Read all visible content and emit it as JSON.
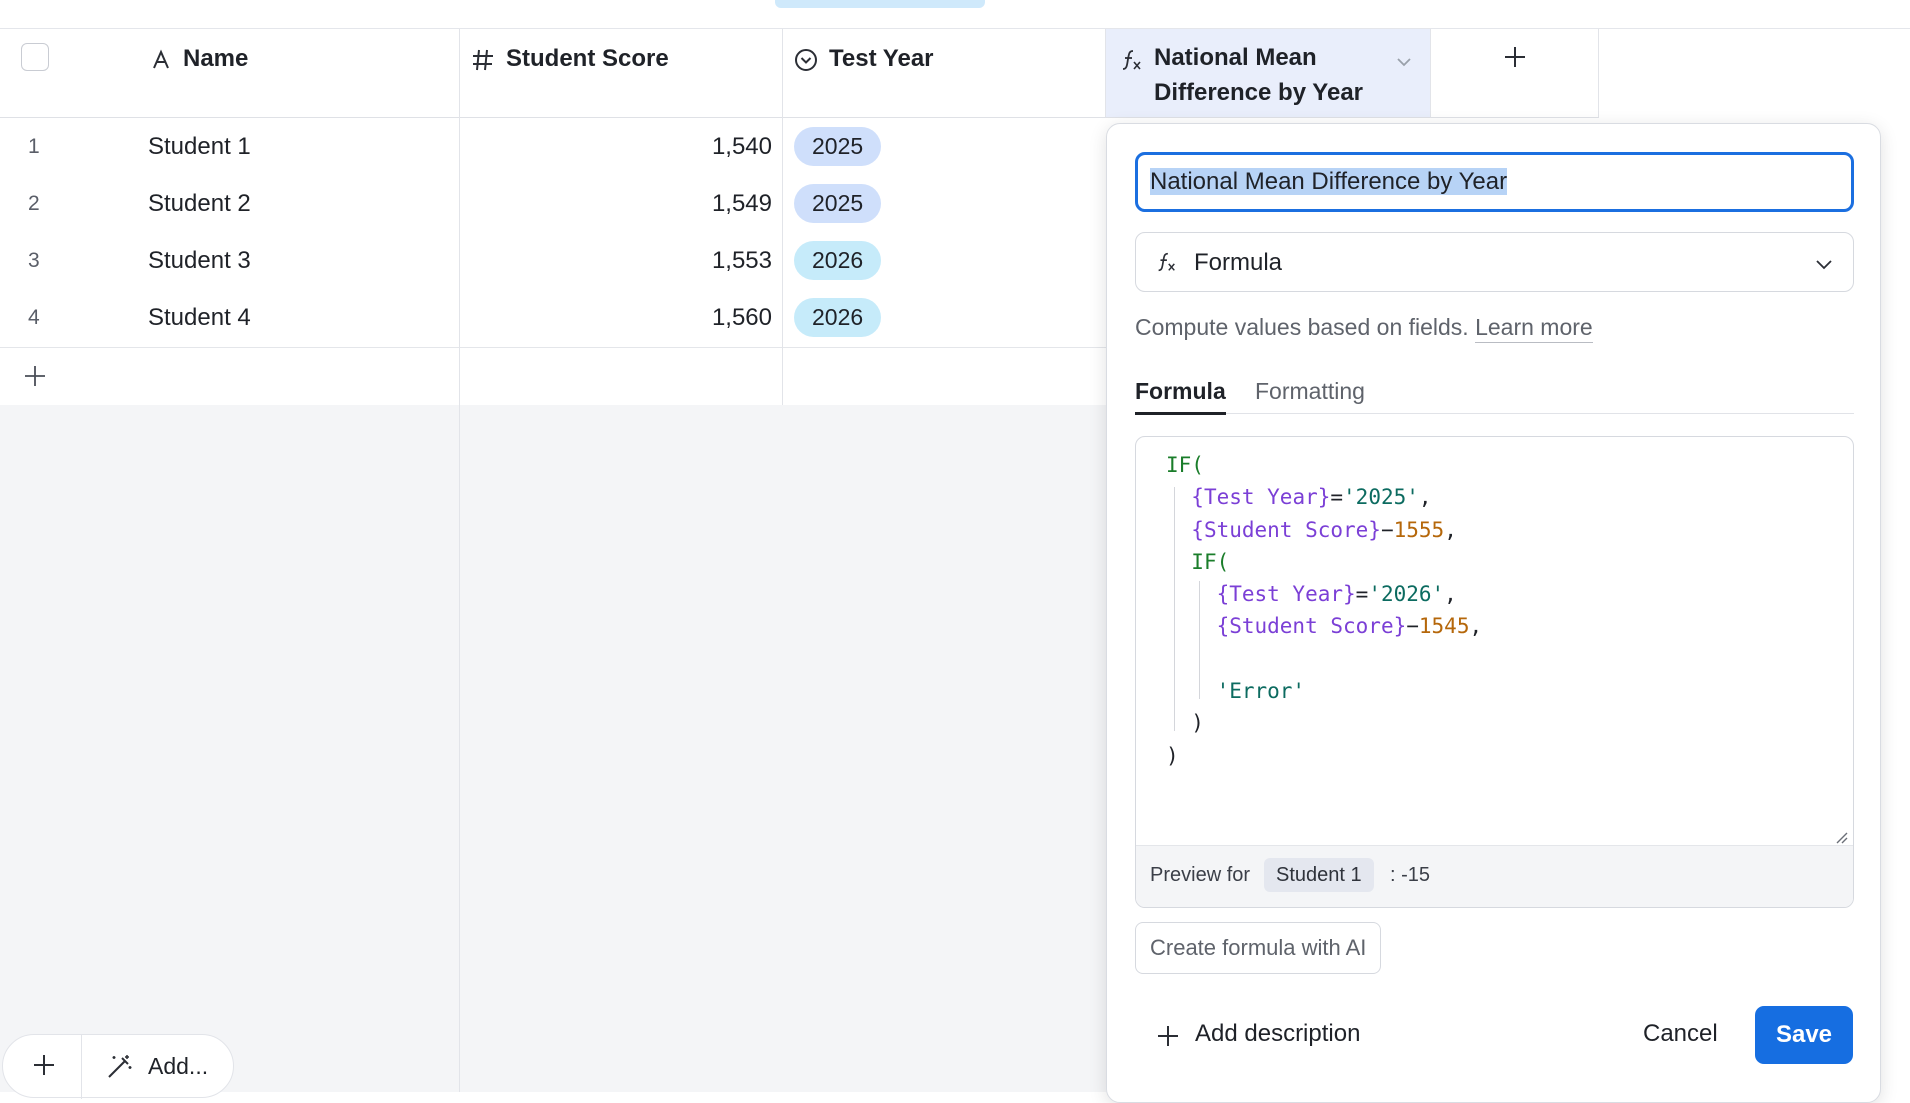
{
  "header": {
    "columns": [
      {
        "label": "Name",
        "icon": "text-type-icon"
      },
      {
        "label": "Student Score",
        "icon": "number-hash-icon"
      },
      {
        "label": "Test Year",
        "icon": "single-select-icon"
      },
      {
        "label_line1": "National Mean",
        "label_line2": "Difference by Year",
        "icon": "formula-icon"
      }
    ],
    "add_column_icon": "plus-icon"
  },
  "rows": [
    {
      "num": "1",
      "name": "Student 1",
      "score": "1,540",
      "year": "2025"
    },
    {
      "num": "2",
      "name": "Student 2",
      "score": "1,549",
      "year": "2025"
    },
    {
      "num": "3",
      "name": "Student 3",
      "score": "1,553",
      "year": "2026"
    },
    {
      "num": "4",
      "name": "Student 4",
      "score": "1,560",
      "year": "2026"
    }
  ],
  "tag_colors": {
    "2025": "#cfdffb",
    "2026": "#c6ebfa"
  },
  "bottom_toolbar": {
    "add_label": "Add..."
  },
  "panel": {
    "field_name": "National Mean Difference by Year",
    "field_type": "Formula",
    "description": "Compute values based on fields.",
    "learn_more": "Learn more",
    "tabs": [
      "Formula",
      "Formatting"
    ],
    "formula": {
      "if1": "IF(",
      "field_test_year": "{Test Year}",
      "eq": "=",
      "year_2025": "'2025'",
      "comma": ",",
      "field_student_score": "{Student Score}",
      "minus": "−",
      "num_1555": "1555",
      "if2": "IF(",
      "year_2026": "'2026'",
      "num_1545": "1545",
      "error": "'Error'",
      "close": ")"
    },
    "preview_label": "Preview for",
    "preview_record": "Student 1",
    "preview_value": ": -15",
    "ai_button": "Create formula with AI",
    "add_description": "Add description",
    "cancel": "Cancel",
    "save": "Save"
  },
  "colors": {
    "accent": "#166ee1",
    "formula_header_bg": "#e9eefb"
  }
}
